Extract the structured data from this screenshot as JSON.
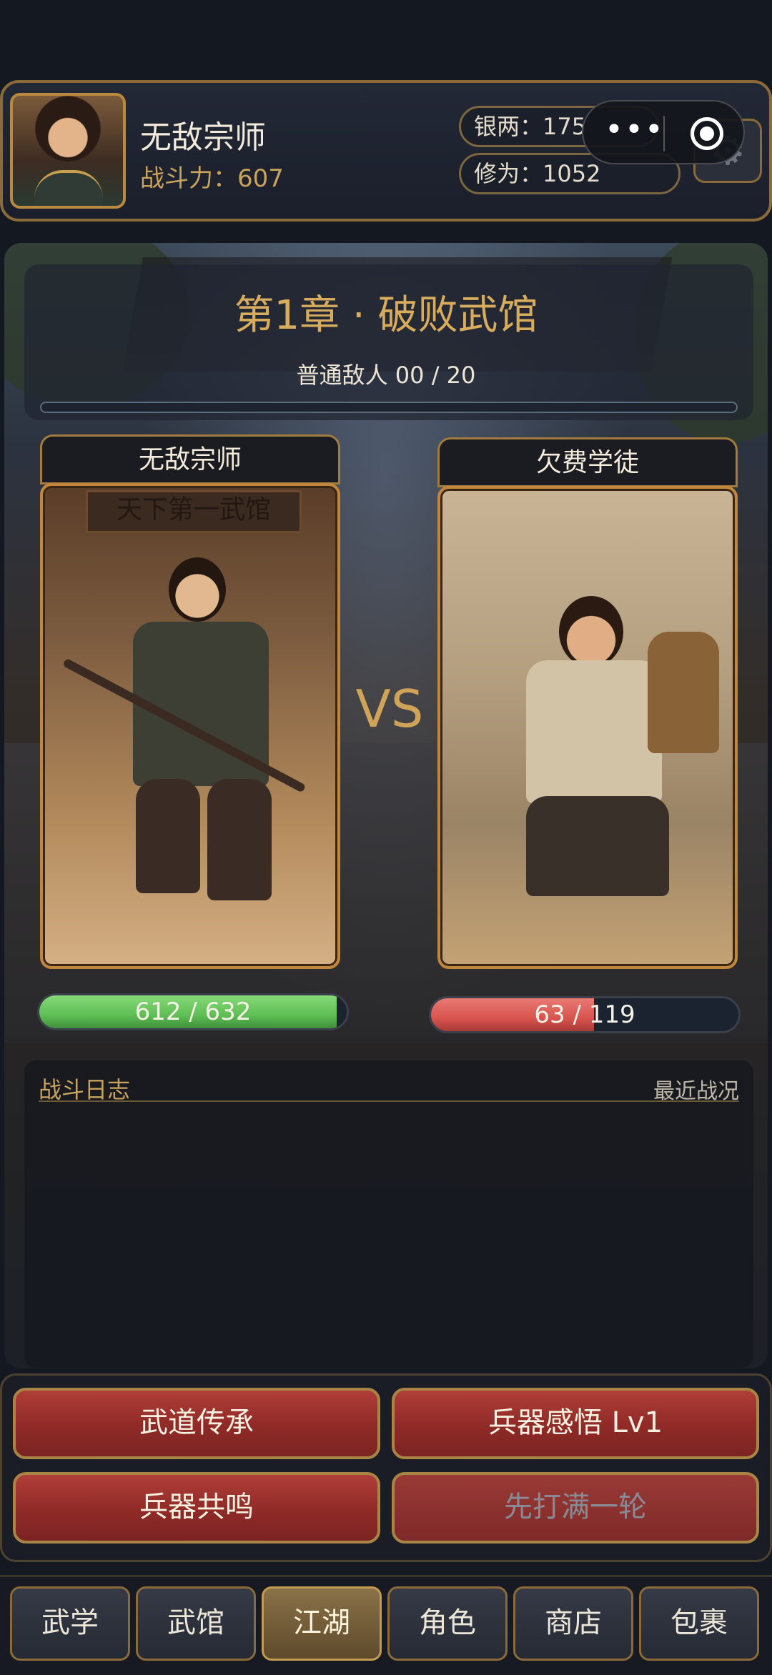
{
  "player": {
    "name": "无敌宗师",
    "power_label": "战斗力：607",
    "silver_label": "银两：175",
    "cultivation_label": "修为：1052"
  },
  "chapter": {
    "title": "第1章 · 破败武馆",
    "enemy_count": "普通敌人  00 / 20",
    "progress": 0.0
  },
  "battle": {
    "left": {
      "name": "无敌宗师",
      "hp_text": "612 / 632",
      "hp": 612,
      "hp_max": 632,
      "sign_text": "天下第一武馆",
      "hp_color": "#5fbf55"
    },
    "right": {
      "name": "欠费学徒",
      "hp_text": "63 / 119",
      "hp": 63,
      "hp_max": 119,
      "hp_color": "#d9544f"
    },
    "vs": "VS"
  },
  "log": {
    "title": "战斗日志",
    "recent_label": "最近战况"
  },
  "actions": [
    {
      "label": "武道传承",
      "enabled": true
    },
    {
      "label": "兵器感悟 Lv1",
      "enabled": true
    },
    {
      "label": "兵器共鸣",
      "enabled": true
    },
    {
      "label": "先打满一轮",
      "enabled": false
    }
  ],
  "nav": {
    "active": "江湖",
    "items": [
      "武学",
      "武馆",
      "江湖",
      "角色",
      "商店",
      "包裹"
    ]
  },
  "mini_program": {
    "more_icon": "more-dots-icon",
    "close_icon": "target-icon"
  },
  "settings_icon": "gear-icon"
}
